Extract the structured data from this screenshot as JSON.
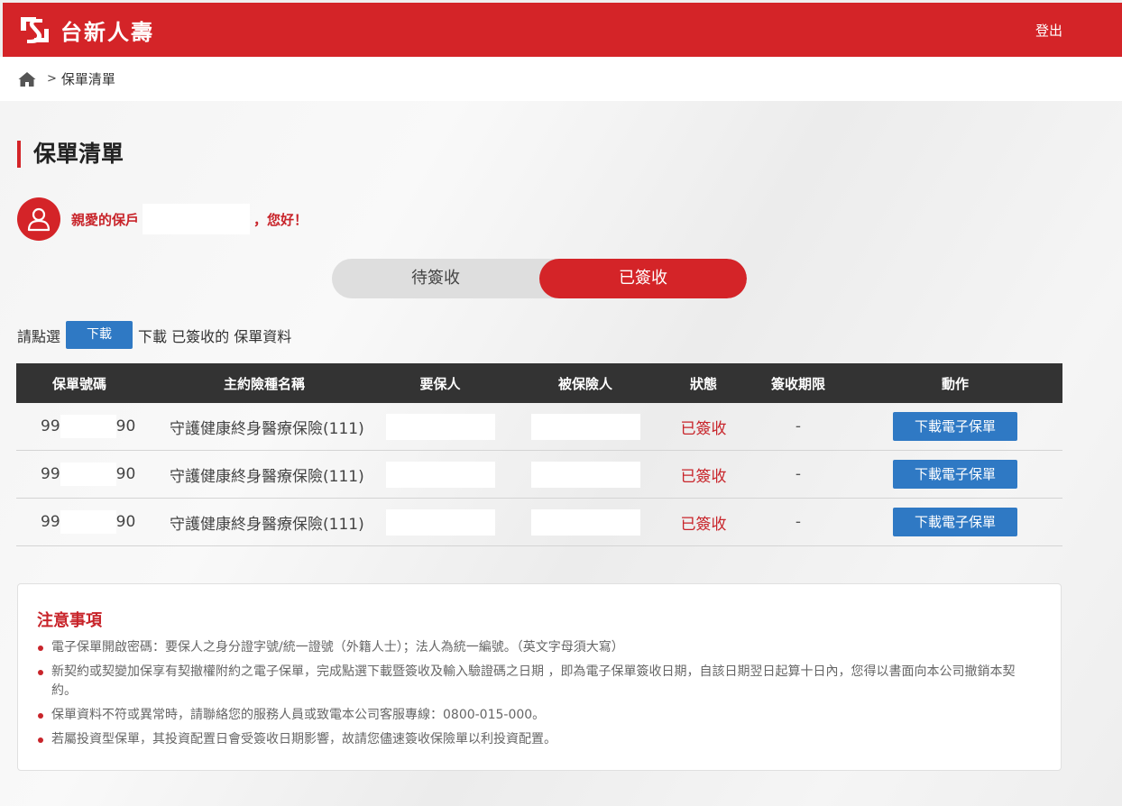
{
  "brand": {
    "name": "台新人壽"
  },
  "header": {
    "logout_label": "登出"
  },
  "breadcrumb": {
    "separator": ">",
    "current": "保單清單"
  },
  "page": {
    "title": "保單清單",
    "greeting_prefix": "親愛的保戶",
    "greeting_suffix": "，您好！"
  },
  "toggle": {
    "pending_label": "待簽收",
    "signed_label": "已簽收",
    "selected": "已簽收"
  },
  "instruction": {
    "before": "請點選",
    "button_label": "下載",
    "after": "下載 已簽收的 保單資料"
  },
  "table": {
    "headers": [
      "保單號碼",
      "主約險種名稱",
      "要保人",
      "被保險人",
      "狀態",
      "簽收期限",
      "動作"
    ],
    "rows": [
      {
        "policy_prefix": "99",
        "policy_suffix": "90",
        "product": "守護健康終身醫療保險(111)",
        "status": "已簽收",
        "deadline": "-",
        "action": "下載電子保單"
      },
      {
        "policy_prefix": "99",
        "policy_suffix": "90",
        "product": "守護健康終身醫療保險(111)",
        "status": "已簽收",
        "deadline": "-",
        "action": "下載電子保單"
      },
      {
        "policy_prefix": "99",
        "policy_suffix": "90",
        "product": "守護健康終身醫療保險(111)",
        "status": "已簽收",
        "deadline": "-",
        "action": "下載電子保單"
      }
    ]
  },
  "notice": {
    "title": "注意事項",
    "items": [
      "電子保單開啟密碼：要保人之身分證字號/統一證號（外籍人士）；法人為統一編號。（英文字母須大寫）",
      "新契約或契變加保享有契撤權附約之電子保單，完成點選下載暨簽收及輸入驗證碼之日期 ，即為電子保單簽收日期，自該日期翌日起算十日內，您得以書面向本公司撤銷本契約。",
      "保單資料不符或異常時，請聯絡您的服務人員或致電本公司客服專線：0800-015-000。",
      "若屬投資型保單，其投資配置日會受簽收日期影響，故請您儘速簽收保險單以利投資配置。"
    ]
  },
  "colors": {
    "brand_red": "#d42428",
    "button_blue": "#2f79c4",
    "header_dark": "#333333"
  }
}
